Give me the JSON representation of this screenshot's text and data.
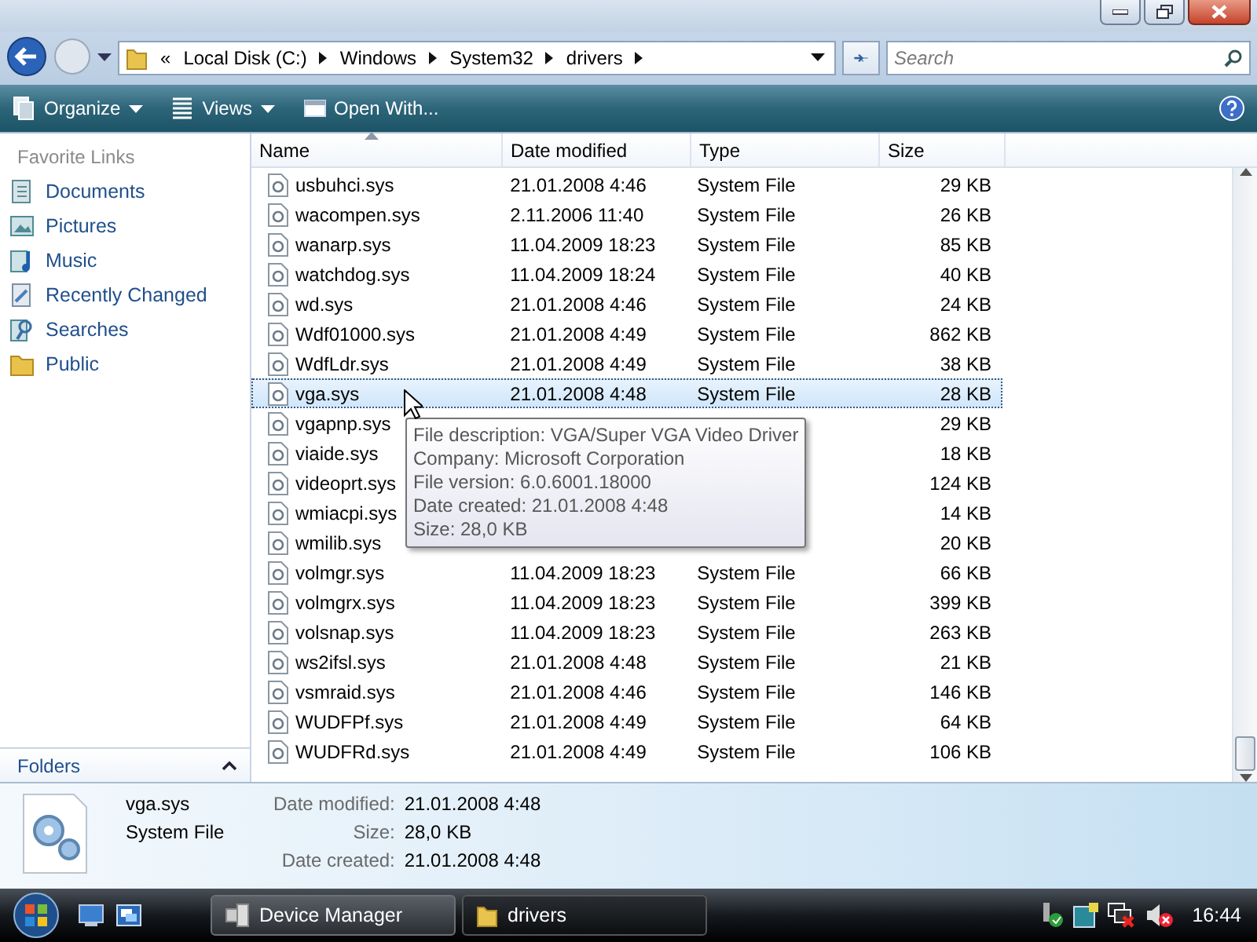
{
  "address": {
    "overflow": "«",
    "crumbs": [
      "Local Disk (C:)",
      "Windows",
      "System32",
      "drivers"
    ]
  },
  "search": {
    "placeholder": "Search"
  },
  "toolbar": [
    {
      "label": "Organize",
      "kind": "organize",
      "dropdown": true
    },
    {
      "label": "Views",
      "kind": "views",
      "dropdown": true
    },
    {
      "label": "Open With...",
      "kind": "openwith",
      "dropdown": false
    }
  ],
  "sidebar": {
    "heading": "Favorite Links",
    "links": [
      {
        "label": "Documents",
        "kind": "documents"
      },
      {
        "label": "Pictures",
        "kind": "pictures"
      },
      {
        "label": "Music",
        "kind": "music"
      },
      {
        "label": "Recently Changed",
        "kind": "recent"
      },
      {
        "label": "Searches",
        "kind": "searches"
      },
      {
        "label": "Public",
        "kind": "public"
      }
    ],
    "folders": "Folders"
  },
  "table": {
    "columns": [
      {
        "label": "Name",
        "sorted": true
      },
      {
        "label": "Date modified",
        "sorted": false
      },
      {
        "label": "Type",
        "sorted": false
      },
      {
        "label": "Size",
        "sorted": false
      }
    ],
    "rows": [
      {
        "name": "usbuhci.sys",
        "date": "21.01.2008 4:46",
        "type": "System File",
        "size": "29 KB",
        "selected": false
      },
      {
        "name": "wacompen.sys",
        "date": "2.11.2006 11:40",
        "type": "System File",
        "size": "26 KB",
        "selected": false
      },
      {
        "name": "wanarp.sys",
        "date": "11.04.2009 18:23",
        "type": "System File",
        "size": "85 KB",
        "selected": false
      },
      {
        "name": "watchdog.sys",
        "date": "11.04.2009 18:24",
        "type": "System File",
        "size": "40 KB",
        "selected": false
      },
      {
        "name": "wd.sys",
        "date": "21.01.2008 4:46",
        "type": "System File",
        "size": "24 KB",
        "selected": false
      },
      {
        "name": "Wdf01000.sys",
        "date": "21.01.2008 4:49",
        "type": "System File",
        "size": "862 KB",
        "selected": false
      },
      {
        "name": "WdfLdr.sys",
        "date": "21.01.2008 4:49",
        "type": "System File",
        "size": "38 KB",
        "selected": false
      },
      {
        "name": "vga.sys",
        "date": "21.01.2008 4:48",
        "type": "System File",
        "size": "28 KB",
        "selected": true
      },
      {
        "name": "vgapnp.sys",
        "size": "29 KB",
        "selected": false
      },
      {
        "name": "viaide.sys",
        "size": "18 KB",
        "selected": false
      },
      {
        "name": "videoprt.sys",
        "size": "124 KB",
        "selected": false
      },
      {
        "name": "wmiacpi.sys",
        "size": "14 KB",
        "selected": false
      },
      {
        "name": "wmilib.sys",
        "size": "20 KB",
        "selected": false
      },
      {
        "name": "volmgr.sys",
        "date": "11.04.2009 18:23",
        "type": "System File",
        "size": "66 KB",
        "selected": false
      },
      {
        "name": "volmgrx.sys",
        "date": "11.04.2009 18:23",
        "type": "System File",
        "size": "399 KB",
        "selected": false
      },
      {
        "name": "volsnap.sys",
        "date": "11.04.2009 18:23",
        "type": "System File",
        "size": "263 KB",
        "selected": false
      },
      {
        "name": "ws2ifsl.sys",
        "date": "21.01.2008 4:48",
        "type": "System File",
        "size": "21 KB",
        "selected": false
      },
      {
        "name": "vsmraid.sys",
        "date": "21.01.2008 4:46",
        "type": "System File",
        "size": "146 KB",
        "selected": false
      },
      {
        "name": "WUDFPf.sys",
        "date": "21.01.2008 4:49",
        "type": "System File",
        "size": "64 KB",
        "selected": false
      },
      {
        "name": "WUDFRd.sys",
        "date": "21.01.2008 4:49",
        "type": "System File",
        "size": "106 KB",
        "selected": false
      }
    ]
  },
  "tooltip": [
    "File description: VGA/Super VGA Video Driver",
    "Company: Microsoft Corporation",
    "File version: 6.0.6001.18000",
    "Date created: 21.01.2008 4:48",
    "Size: 28,0 KB"
  ],
  "details": {
    "name": "vga.sys",
    "type": "System File",
    "fields": [
      {
        "label": "Date modified:",
        "value": "21.01.2008 4:48"
      },
      {
        "label": "Size:",
        "value": "28,0 KB"
      },
      {
        "label": "Date created:",
        "value": "21.01.2008 4:48"
      }
    ]
  },
  "taskbar": {
    "buttons": [
      {
        "label": "Device Manager",
        "kind": "devmgr",
        "active": false
      },
      {
        "label": "drivers",
        "kind": "folder",
        "active": true
      }
    ],
    "clock": "16:44"
  }
}
